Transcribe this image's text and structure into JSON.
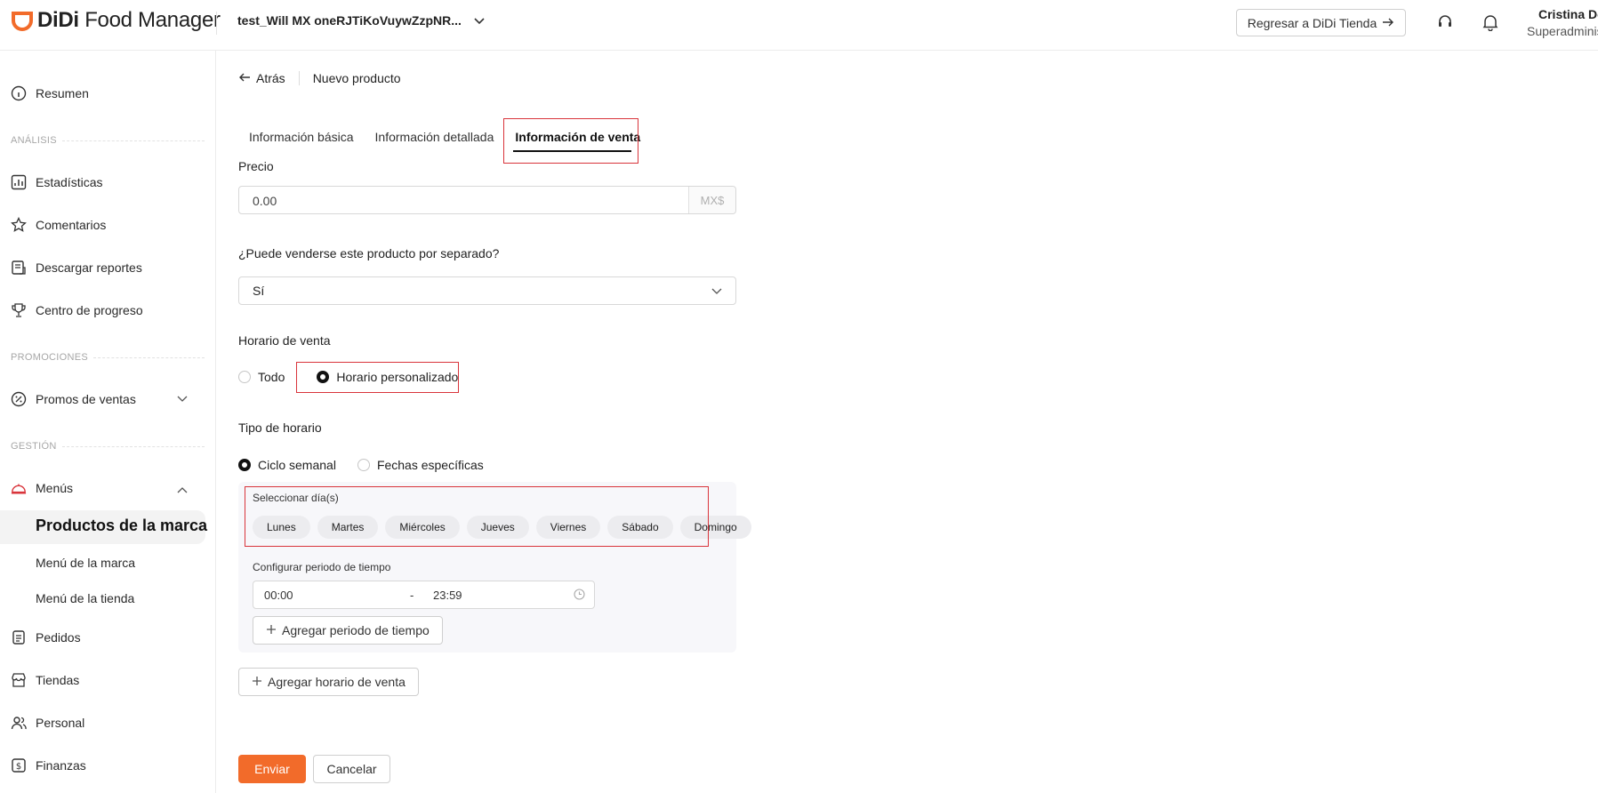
{
  "app": {
    "logo_brand": "DiDi",
    "logo_product": "Food Manager",
    "store_name": "test_Will MX oneRJTiKoVuywZzpNR...",
    "back_to_store": "Regresar a DiDi Tienda",
    "user_name": "Cristina De",
    "user_role": "Superadminis"
  },
  "sidebar": {
    "resumen": "Resumen",
    "analisis_label": "ANÁLISIS",
    "estadisticas": "Estadísticas",
    "comentarios": "Comentarios",
    "descargar": "Descargar reportes",
    "progreso": "Centro de progreso",
    "promociones_label": "PROMOCIONES",
    "promos": "Promos de ventas",
    "gestion_label": "GESTIÓN",
    "menus": "Menús",
    "productos_marca": "Productos de la marca",
    "menu_marca": "Menú de la marca",
    "menu_tienda": "Menú de la tienda",
    "pedidos": "Pedidos",
    "tiendas": "Tiendas",
    "personal": "Personal",
    "finanzas": "Finanzas"
  },
  "breadcrumb": {
    "back": "Atrás",
    "current": "Nuevo producto"
  },
  "tabs": [
    {
      "label": "Información básica"
    },
    {
      "label": "Información detallada"
    },
    {
      "label": "Información de venta"
    }
  ],
  "form": {
    "price_label": "Precio",
    "price_value": "0.00",
    "price_suffix": "MX$",
    "separate_label": "¿Puede venderse este producto por separado?",
    "separate_value": "Sí",
    "schedule_label": "Horario de venta",
    "schedule_opt_all": "Todo",
    "schedule_opt_custom": "Horario personalizado",
    "schedule_type_label": "Tipo de horario",
    "type_weekly": "Ciclo semanal",
    "type_dates": "Fechas específicas",
    "select_days_label": "Seleccionar día(s)",
    "days": [
      "Lunes",
      "Martes",
      "Miércoles",
      "Jueves",
      "Viernes",
      "Sábado",
      "Domingo"
    ],
    "time_period_label": "Configurar periodo de tiempo",
    "time_start": "00:00",
    "time_sep": "-",
    "time_end": "23:59",
    "add_period": "Agregar periodo de tiempo",
    "add_schedule": "Agregar horario de venta"
  },
  "actions": {
    "submit": "Enviar",
    "cancel": "Cancelar"
  },
  "colors": {
    "accent": "#F26B2A",
    "highlight_box": "#D9343B"
  }
}
